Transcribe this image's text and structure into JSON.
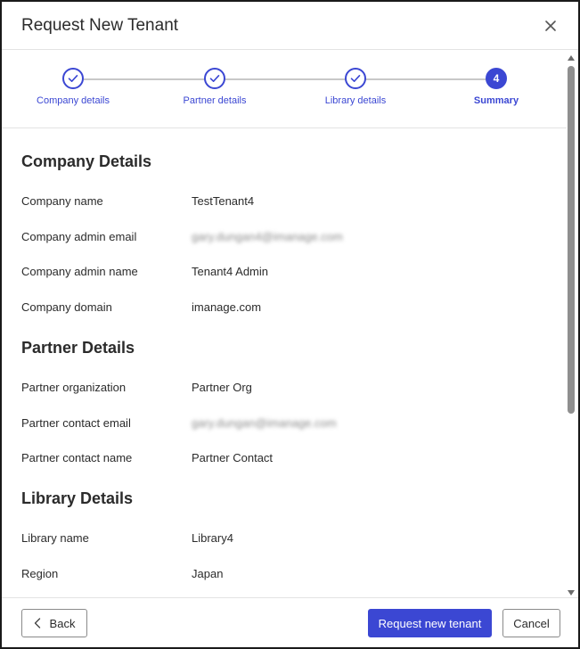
{
  "dialog": {
    "title": "Request New Tenant"
  },
  "stepper": {
    "steps": [
      {
        "label": "Company details",
        "state": "complete"
      },
      {
        "label": "Partner details",
        "state": "complete"
      },
      {
        "label": "Library details",
        "state": "complete"
      },
      {
        "label": "Summary",
        "state": "active",
        "number": "4"
      }
    ]
  },
  "company": {
    "heading": "Company Details",
    "rows": [
      {
        "label": "Company name",
        "value": "TestTenant4"
      },
      {
        "label": "Company admin email",
        "value": "gary.dungan4@imanage.com"
      },
      {
        "label": "Company admin name",
        "value": "Tenant4 Admin"
      },
      {
        "label": "Company domain",
        "value": "imanage.com"
      }
    ]
  },
  "partner": {
    "heading": "Partner Details",
    "rows": [
      {
        "label": "Partner organization",
        "value": "Partner Org"
      },
      {
        "label": "Partner contact email",
        "value": "gary.dungan@imanage.com"
      },
      {
        "label": "Partner contact name",
        "value": "Partner Contact"
      }
    ]
  },
  "library": {
    "heading": "Library Details",
    "rows": [
      {
        "label": "Library name",
        "value": "Library4"
      },
      {
        "label": "Region",
        "value": "Japan"
      }
    ]
  },
  "footer": {
    "back_label": "Back",
    "submit_label": "Request new tenant",
    "cancel_label": "Cancel"
  },
  "colors": {
    "accent": "#3b47d3",
    "border": "#1a1a1a",
    "divider": "#e3e3e3"
  },
  "icons": {
    "close": "close-icon",
    "check": "check-icon",
    "back": "chevron-left-icon"
  }
}
